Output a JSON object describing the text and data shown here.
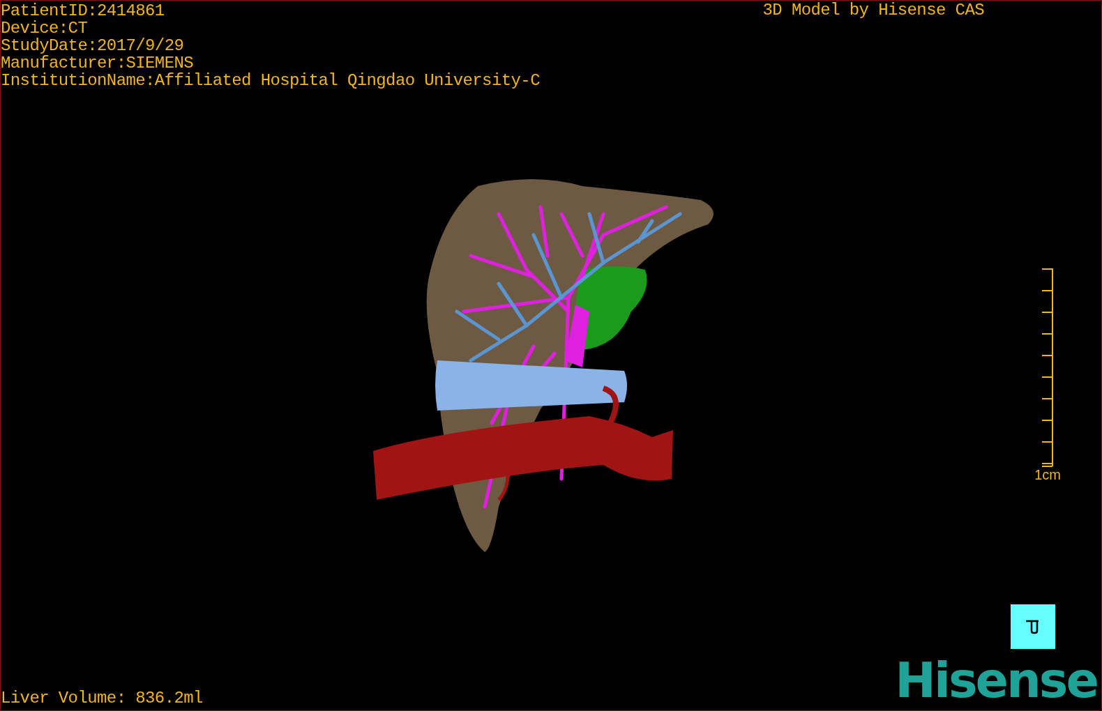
{
  "patient_info": [
    "PatientID:2414861",
    "Device:CT",
    "StudyDate:2017/9/29",
    "Manufacturer:SIEMENS",
    "InstitutionName:Affiliated Hospital Qingdao University-C"
  ],
  "title": "3D Model by Hisense CAS",
  "scale_bar": {
    "label": "1cm"
  },
  "liver_volume": "Liver Volume: 836.2ml",
  "logo": "Hisense"
}
